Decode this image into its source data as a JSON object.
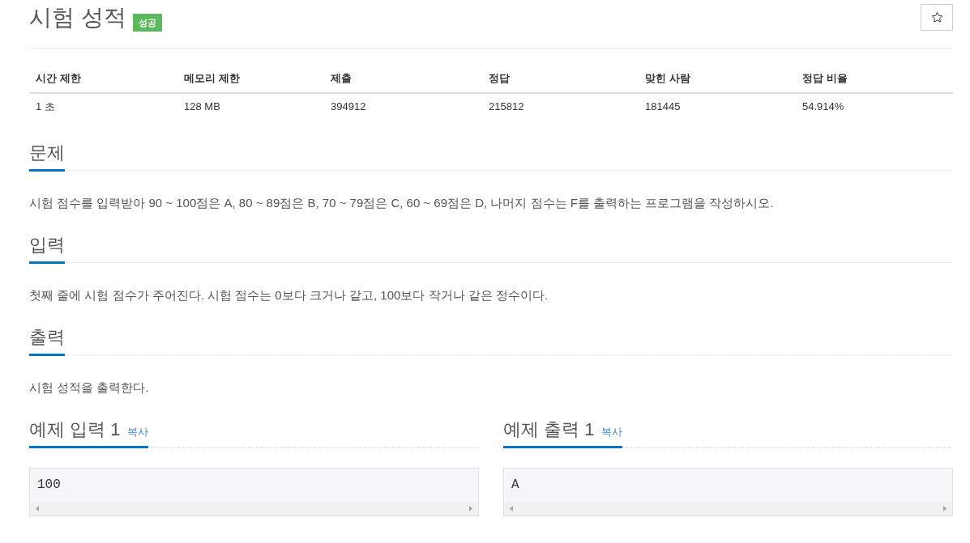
{
  "problem": {
    "title": "시험 성적",
    "result_badge": "성공",
    "starred": false
  },
  "info_table": {
    "columns": [
      "시간 제한",
      "메모리 제한",
      "제출",
      "정답",
      "맞힌 사람",
      "정답 비율"
    ],
    "rows": [
      [
        "1 초",
        "128 MB",
        "394912",
        "215812",
        "181445",
        "54.914%"
      ]
    ]
  },
  "sections": [
    {
      "heading": "문제",
      "body": "시험 점수를 입력받아 90 ~ 100점은 A, 80 ~ 89점은 B, 70 ~ 79점은 C, 60 ~ 69점은 D, 나머지 점수는 F를 출력하는 프로그램을 작성하시오."
    },
    {
      "heading": "입력",
      "body": "첫째 줄에 시험 점수가 주어진다. 시험 점수는 0보다 크거나 같고, 100보다 작거나 같은 정수이다."
    },
    {
      "heading": "출력",
      "body": "시험 성적을 출력한다."
    }
  ],
  "samples": [
    {
      "heading": "예제 입력 1",
      "copy_link": "복사",
      "content": "100"
    },
    {
      "heading": "예제 출력 1",
      "copy_link": "복사",
      "content": "A"
    }
  ]
}
